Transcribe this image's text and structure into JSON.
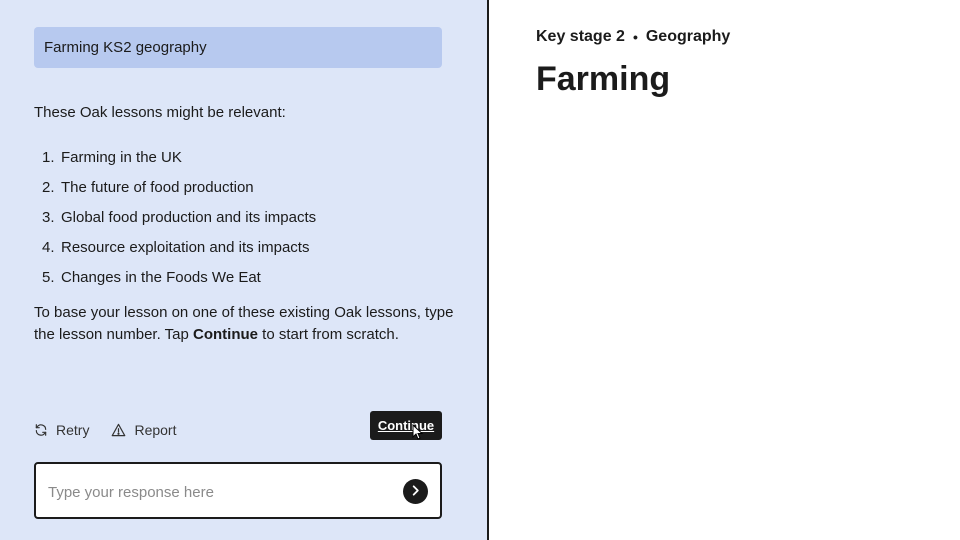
{
  "chat": {
    "user_message": "Farming KS2 geography",
    "intro": "These Oak lessons might be relevant:",
    "lessons": [
      {
        "num": "1.",
        "title": "Farming in the UK"
      },
      {
        "num": "2.",
        "title": "The future of food production"
      },
      {
        "num": "3.",
        "title": "Global food production and its impacts"
      },
      {
        "num": "4.",
        "title": "Resource exploitation and its impacts"
      },
      {
        "num": "5.",
        "title": "Changes in the Foods We Eat"
      }
    ],
    "instruction_pre": "To base your lesson on one of these existing Oak lessons, type the lesson number. Tap ",
    "instruction_bold": "Continue",
    "instruction_post": " to start from scratch.",
    "retry_label": "Retry",
    "report_label": "Report",
    "continue_label": "Continue",
    "input_placeholder": "Type your response here"
  },
  "lesson": {
    "key_stage": "Key stage 2",
    "separator": "•",
    "subject": "Geography",
    "title": "Farming"
  },
  "colors": {
    "chat_bg": "#dde6f8",
    "user_bubble": "#b7c9ef",
    "dark": "#1b1b1b"
  },
  "icons": {
    "retry": "refresh-icon",
    "report": "warning-icon",
    "send": "chevron-right-icon"
  }
}
